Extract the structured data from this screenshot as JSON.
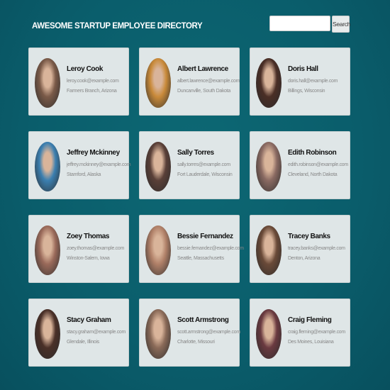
{
  "header": {
    "title": "AWESOME STARTUP EMPLOYEE DIRECTORY",
    "search_placeholder": "",
    "search_button": "Search"
  },
  "employees": [
    {
      "name": "Leroy Cook",
      "email": "leroy.cook@example.com",
      "location": "Farmers Branch, Arizona",
      "avatar_color": "#7a5a48"
    },
    {
      "name": "Albert Lawrence",
      "email": "albert.lawrence@example.com",
      "location": "Duncanville, South Dakota",
      "avatar_color": "#c98a3a"
    },
    {
      "name": "Doris Hall",
      "email": "doris.hall@example.com",
      "location": "Billings, Wisconsin",
      "avatar_color": "#4a2e26"
    },
    {
      "name": "Jeffrey Mckinney",
      "email": "jeffrey.mckinney@example.com",
      "location": "Stamford, Alaska",
      "avatar_color": "#3b7fb0"
    },
    {
      "name": "Sally Torres",
      "email": "sally.torres@example.com",
      "location": "Fort Lauderdale, Wisconsin",
      "avatar_color": "#5a4038"
    },
    {
      "name": "Edith Robinson",
      "email": "edith.robinson@example.com",
      "location": "Cleveland, North Dakota",
      "avatar_color": "#8a6a62"
    },
    {
      "name": "Zoey Thomas",
      "email": "zoey.thomas@example.com",
      "location": "Winston-Salem, Iowa",
      "avatar_color": "#9a6a5a"
    },
    {
      "name": "Bessie Fernandez",
      "email": "bessie.fernandez@example.com",
      "location": "Seattle, Massachusetts",
      "avatar_color": "#b08068"
    },
    {
      "name": "Tracey Banks",
      "email": "tracey.banks@example.com",
      "location": "Denton, Arizona",
      "avatar_color": "#6a4a38"
    },
    {
      "name": "Stacy Graham",
      "email": "stacy.graham@example.com",
      "location": "Glendale, Illinois",
      "avatar_color": "#4a3028"
    },
    {
      "name": "Scott Armstrong",
      "email": "scott.armstrong@example.com",
      "location": "Charlotte, Missouri",
      "avatar_color": "#8a6a58"
    },
    {
      "name": "Craig Fleming",
      "email": "craig.fleming@example.com",
      "location": "Des Moines, Louisiana",
      "avatar_color": "#6a3a40"
    }
  ]
}
